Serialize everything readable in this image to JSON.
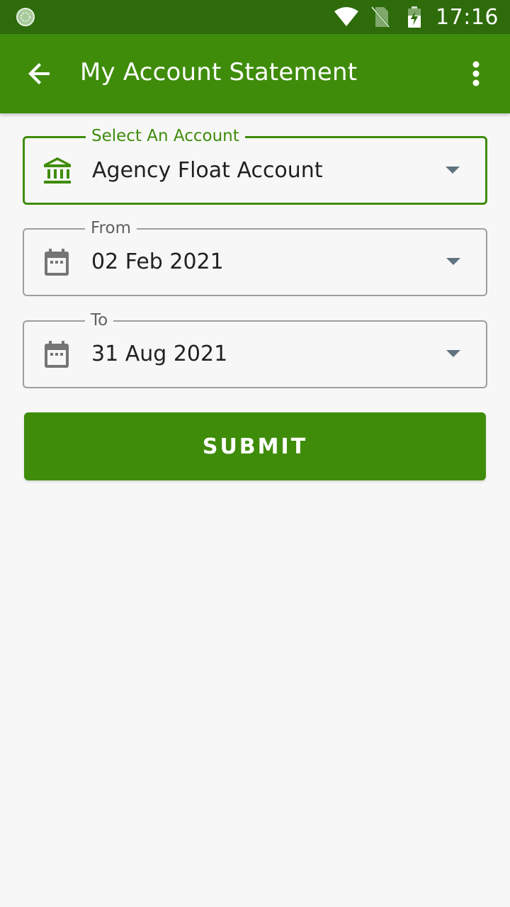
{
  "status_bar": {
    "time": "17:16",
    "icons": [
      "sync-icon",
      "wifi-icon",
      "no-sim-icon",
      "battery-charging-icon"
    ]
  },
  "app_bar": {
    "title": "My Account Statement",
    "back_icon": "arrow-left-icon",
    "menu_icon": "more-vert-icon"
  },
  "form": {
    "account": {
      "label": "Select An Account",
      "value": "Agency Float Account",
      "icon": "bank-icon"
    },
    "from": {
      "label": "From",
      "value": "02 Feb 2021",
      "icon": "calendar-icon"
    },
    "to": {
      "label": "To",
      "value": "31 Aug 2021",
      "icon": "calendar-icon"
    },
    "submit_label": "SUBMIT"
  },
  "colors": {
    "status_bar": "#2d6b0b",
    "primary": "#3f8c0b",
    "background": "#f7f7f7",
    "border": "#9e9e9e",
    "dropdown_arrow": "#5f7480",
    "icon_gray": "#757575"
  }
}
